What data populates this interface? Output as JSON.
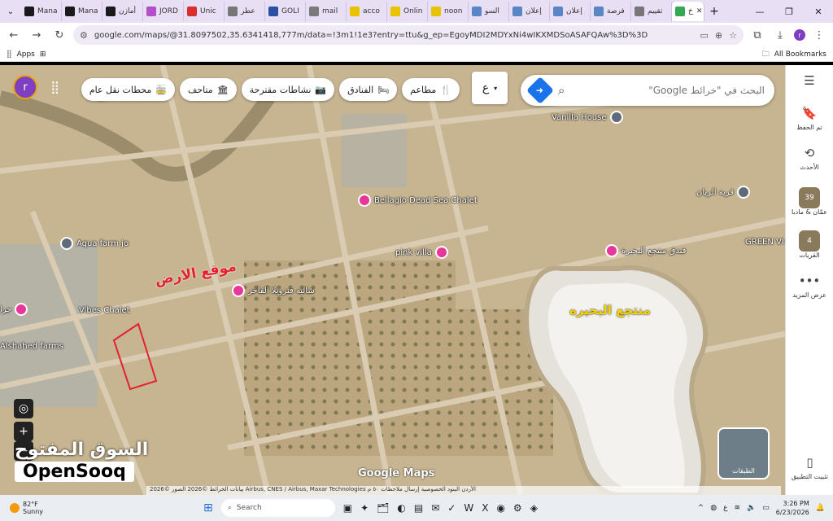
{
  "browser": {
    "tabs": [
      {
        "label": "Mana",
        "color": "#1a1a1a"
      },
      {
        "label": "Mana",
        "color": "#1a1a1a"
      },
      {
        "label": "أمازن",
        "color": "#1a1a1a"
      },
      {
        "label": "JORD",
        "color": "#b34fc8"
      },
      {
        "label": "Unic",
        "color": "#d9302c"
      },
      {
        "label": "عطر",
        "color": "#777777"
      },
      {
        "label": "GOLI",
        "color": "#2b4fa3"
      },
      {
        "label": "mail",
        "color": "#7a7a7a"
      },
      {
        "label": "acco",
        "color": "#e9c200"
      },
      {
        "label": "Onlin",
        "color": "#e9c200"
      },
      {
        "label": "noon",
        "color": "#e9c200"
      },
      {
        "label": "السو",
        "color": "#5a86c5"
      },
      {
        "label": "إعلان",
        "color": "#5a86c5"
      },
      {
        "label": "إعلان",
        "color": "#5a86c5"
      },
      {
        "label": "فرصة",
        "color": "#5a86c5"
      },
      {
        "label": "تقييم",
        "color": "#777777"
      },
      {
        "label": "خ",
        "color": "#34a853",
        "active": true
      }
    ],
    "new_tab_label": "+",
    "url": "google.com/maps/@31.8097502,35.6341418,777m/data=!3m1!1e3?entry=ttu&g_ep=EgoyMDI2MDYxNi4wIKXMDSoASAFQAw%3D%3D",
    "bookmarks": {
      "apps": "Apps",
      "all": "All Bookmarks"
    },
    "profile_letter": "r"
  },
  "map": {
    "search_placeholder": "البحث في \"خرائط Google\"",
    "language_btn": "ع",
    "chips": [
      {
        "icon": "🍴",
        "label": "مطاعم"
      },
      {
        "icon": "🛏",
        "label": "الفنادق"
      },
      {
        "icon": "📷",
        "label": "نشاطات مقترحة"
      },
      {
        "icon": "🏛",
        "label": "متاحف"
      },
      {
        "icon": "🚋",
        "label": "محطات نقل عام"
      }
    ],
    "avatar_letter": "r",
    "places": [
      {
        "name": "Vanilla House",
        "type": "gray"
      },
      {
        "name": "قرية الريان",
        "type": "gray"
      },
      {
        "name": "Bellagio Dead Sea Chalet",
        "type": "pink"
      },
      {
        "name": "Aqua farm jo",
        "type": "gray"
      },
      {
        "name": "pink villa",
        "type": "pink"
      },
      {
        "name": "فندق منتجع البحيرة",
        "type": "pink"
      },
      {
        "name": "GREEN VI",
        "type": "none"
      },
      {
        "name": "شاليه فنزويلا الفاخر",
        "type": "pink"
      },
      {
        "name": "Vibes Chalet",
        "type": "none"
      },
      {
        "name": "جرا",
        "type": "pink"
      },
      {
        "name": "Alshahed farms",
        "type": "none"
      }
    ],
    "land_label": "موقع الارض",
    "resort_label": "منتجع البحيره",
    "watermark": "Google Maps",
    "layers_label": "الطبقات",
    "attribution": "بيانات الخرائط ©2026 الصور ©2026 Airbus, CNES / Airbus, Maxar Technologies  الأردن  البنود  الخصوصية  إرسال ملاحظات  ٥٠ م",
    "colors": {
      "land_outline": "#e3212f",
      "resort_text": "#f5d300"
    }
  },
  "rail": {
    "items": [
      {
        "icon": "☰",
        "label": ""
      },
      {
        "icon": "🔖",
        "label": "تم الحفظ"
      },
      {
        "icon": "⟲",
        "label": "الأحدث"
      },
      {
        "icon": "39",
        "label": "عمّان & مادبا"
      },
      {
        "icon": "4",
        "label": "القريات"
      },
      {
        "icon": "•••",
        "label": "عرض المزيد"
      }
    ],
    "install_label": "تثبيت التطبيق"
  },
  "watermark_brand": {
    "ar": "السوق المفتوح",
    "en": "OpenSooq"
  },
  "taskbar": {
    "weather_temp": "82°F",
    "weather_desc": "Sunny",
    "search": "Search",
    "lang": "ع",
    "time": "3:26 PM",
    "date": "6/23/2026"
  }
}
